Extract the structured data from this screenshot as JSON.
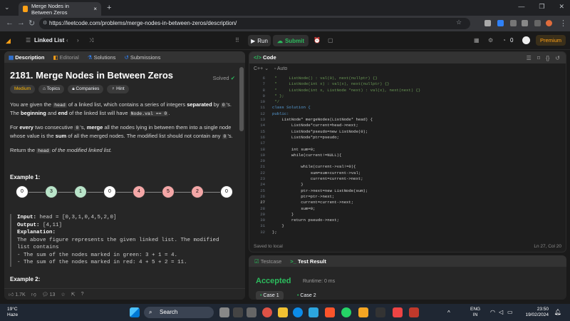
{
  "browser": {
    "tab_title": "Merge Nodes in Between Zeros",
    "tab_close": "×",
    "newtab": "+",
    "url": "https://leetcode.com/problems/merge-nodes-in-between-zeros/description/"
  },
  "lc": {
    "list_name": "Linked List",
    "run": "Run",
    "submit": "Submit",
    "streak": "0",
    "premium": "Premium"
  },
  "left": {
    "tabs": [
      "Description",
      "Editorial",
      "Solutions",
      "Submissions"
    ],
    "title": "2181. Merge Nodes in Between Zeros",
    "solved": "Solved",
    "difficulty": "Medium",
    "tags": [
      "Topics",
      "Companies",
      "Hint"
    ],
    "p1a": "You are given the ",
    "p1_head": "head",
    "p1b": " of a linked list, which contains a series of integers ",
    "p1_sep": "separated",
    "p1c": " by ",
    "p1_zero": "0",
    "p1d": "'s. The ",
    "p1_beg": "beginning",
    "p1e": " and ",
    "p1_end": "end",
    "p1f": " of the linked list will have ",
    "p1_code": "Node.val == 0",
    "p1g": ".",
    "p2a": "For ",
    "p2_every": "every",
    "p2b": " two consecutive ",
    "p2_zero": "0",
    "p2c": "'s, ",
    "p2_merge": "merge",
    "p2d": " all the nodes lying in between them into a single node whose value is the ",
    "p2_sum": "sum",
    "p2e": " of all the merged nodes. The modified list should not contain any ",
    "p2_zero2": "0",
    "p2f": "'s.",
    "p3a": "Return the ",
    "p3_head": "head",
    "p3b": " of the modified linked list.",
    "example1": "Example 1:",
    "nodes": [
      {
        "v": "0",
        "color": "#ffffff"
      },
      {
        "v": "3",
        "color": "#b9e4c9"
      },
      {
        "v": "1",
        "color": "#b9e4c9"
      },
      {
        "v": "0",
        "color": "#ffffff"
      },
      {
        "v": "4",
        "color": "#f4a7a7"
      },
      {
        "v": "5",
        "color": "#f4a7a7"
      },
      {
        "v": "2",
        "color": "#f4a7a7"
      },
      {
        "v": "0",
        "color": "#ffffff"
      }
    ],
    "input_label": "Input:",
    "input_val": " head = [0,3,1,0,4,5,2,0]",
    "output_label": "Output:",
    "output_val": " [4,11]",
    "expl_label": "Explanation:",
    "expl1": "The above figure represents the given linked list. The modified list contains",
    "expl2": "- The sum of the nodes marked in green: 3 + 1 = 4.",
    "expl3": "- The sum of the nodes marked in red: 4 + 5 + 2 = 11.",
    "example2": "Example 2:",
    "likes": "1.7K",
    "comments": "13"
  },
  "code": {
    "header": "Code",
    "lang": "C++",
    "auto": "Auto",
    "saved": "Saved to local",
    "lncol": "Ln 27, Col 20",
    "lines": [
      {
        "n": "6",
        "t": " *     ListNode() : val(0), next(nullptr) {}",
        "c": "cm"
      },
      {
        "n": "7",
        "t": " *     ListNode(int x) : val(x), next(nullptr) {}",
        "c": "cm"
      },
      {
        "n": "8",
        "t": " *     ListNode(int x, ListNode *next) : val(x), next(next) {}",
        "c": "cm"
      },
      {
        "n": "9",
        "t": " * };",
        "c": "cm"
      },
      {
        "n": "10",
        "t": " */",
        "c": "cm"
      },
      {
        "n": "11",
        "t": "class Solution {",
        "c": "kw"
      },
      {
        "n": "12",
        "t": "public:",
        "c": "kw"
      },
      {
        "n": "13",
        "t": "    ListNode* mergeNodes(ListNode* head) {",
        "c": "str"
      },
      {
        "n": "14",
        "t": "        ListNode*current=head->next;",
        "c": "str"
      },
      {
        "n": "15",
        "t": "        ListNode*pseudo=new ListNode(0);",
        "c": "str"
      },
      {
        "n": "16",
        "t": "        ListNode*ptr=pseudo;",
        "c": "str"
      },
      {
        "n": "17",
        "t": "",
        "c": "str"
      },
      {
        "n": "18",
        "t": "        int sum=0;",
        "c": "str"
      },
      {
        "n": "19",
        "t": "        while(current!=NULL){",
        "c": "str"
      },
      {
        "n": "20",
        "t": "",
        "c": "str"
      },
      {
        "n": "21",
        "t": "            while(current->val!=0){",
        "c": "str"
      },
      {
        "n": "22",
        "t": "                sum=sum+current->val;",
        "c": "str"
      },
      {
        "n": "23",
        "t": "                current=current->next;",
        "c": "str"
      },
      {
        "n": "24",
        "t": "            }",
        "c": "str"
      },
      {
        "n": "25",
        "t": "            ptr->next=new ListNode(sum);",
        "c": "str"
      },
      {
        "n": "26",
        "t": "            ptr=ptr->next;",
        "c": "str"
      },
      {
        "n": "27",
        "t": "            current=current->next;",
        "c": "str"
      },
      {
        "n": "28",
        "t": "            sum=0;",
        "c": "str"
      },
      {
        "n": "29",
        "t": "        }",
        "c": "str"
      },
      {
        "n": "30",
        "t": "        return pseudo->next;",
        "c": "str"
      },
      {
        "n": "31",
        "t": "    }",
        "c": "str"
      },
      {
        "n": "32",
        "t": "};",
        "c": "str"
      }
    ]
  },
  "test": {
    "tab1": "Testcase",
    "tab2": "Test Result",
    "accepted": "Accepted",
    "runtime": "Runtime: 0 ms",
    "case1": "Case 1",
    "case2": "Case 2"
  },
  "taskbar": {
    "temp": "19°C",
    "weather": "Haze",
    "search": "Search",
    "lang1": "ENG",
    "lang2": "IN",
    "time": "23:50",
    "date": "19/02/2024"
  }
}
